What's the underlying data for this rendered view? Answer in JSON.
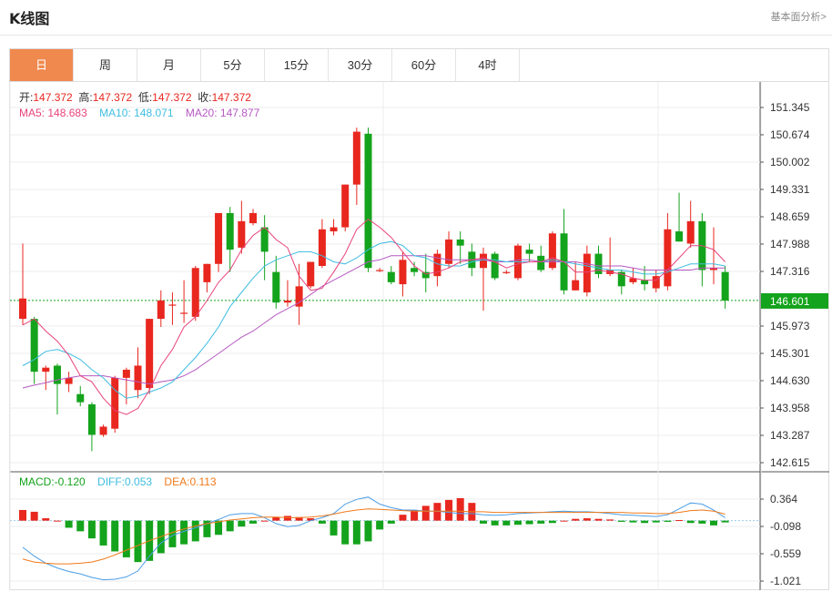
{
  "header": {
    "title": "K线图",
    "fund_link": "基本面分析>"
  },
  "tabs": [
    {
      "label": "日",
      "active": true
    },
    {
      "label": "周",
      "active": false
    },
    {
      "label": "月",
      "active": false
    },
    {
      "label": "5分",
      "active": false
    },
    {
      "label": "15分",
      "active": false
    },
    {
      "label": "30分",
      "active": false
    },
    {
      "label": "60分",
      "active": false
    },
    {
      "label": "4时",
      "active": false
    }
  ],
  "ohlc_info": {
    "open_label": "开:",
    "open": "147.372",
    "high_label": "高:",
    "high": "147.372",
    "low_label": "低:",
    "low": "147.372",
    "close_label": "收:",
    "close": "147.372"
  },
  "ma_info": {
    "ma5_label": "MA5:",
    "ma5": "148.683",
    "ma10_label": "MA10:",
    "ma10": "148.071",
    "ma20_label": "MA20:",
    "ma20": "147.877"
  },
  "macd_info": {
    "macd_label": "MACD:",
    "macd": "-0.120",
    "diff_label": "DIFF:",
    "diff": "0.053",
    "dea_label": "DEA:",
    "dea": "0.113"
  },
  "colors": {
    "up": "#e8271f",
    "down": "#14a31c",
    "ma5": "#e8437c",
    "ma10": "#3fbde0",
    "ma20": "#b659c2",
    "diff": "#4a9de6",
    "dea": "#f07a1a",
    "current_price_bg": "#14a31c",
    "active_tab": "#f0894e"
  },
  "chart_data": {
    "type": "candlestick",
    "current_price": "146.601",
    "current_price_value": 146.601,
    "y_ticks": [
      "151.345",
      "150.674",
      "150.002",
      "149.331",
      "148.659",
      "147.988",
      "147.316",
      "146.601",
      "145.973",
      "145.301",
      "144.630",
      "143.958",
      "143.287",
      "142.615"
    ],
    "macd_ticks": [
      "0.364",
      "-0.098",
      "-0.559",
      "-1.021"
    ],
    "ylim": [
      142.615,
      151.345
    ],
    "macd_ylim": [
      -1.021,
      0.364
    ],
    "candles": [
      {
        "o": 146.15,
        "h": 148.0,
        "l": 146.0,
        "c": 146.65
      },
      {
        "o": 146.15,
        "h": 146.2,
        "l": 144.55,
        "c": 144.85
      },
      {
        "o": 144.85,
        "h": 145.0,
        "l": 144.4,
        "c": 144.95
      },
      {
        "o": 145.0,
        "h": 145.05,
        "l": 143.8,
        "c": 144.55
      },
      {
        "o": 144.55,
        "h": 144.85,
        "l": 144.35,
        "c": 144.7
      },
      {
        "o": 144.3,
        "h": 144.5,
        "l": 144.0,
        "c": 144.1
      },
      {
        "o": 144.05,
        "h": 144.1,
        "l": 142.9,
        "c": 143.3
      },
      {
        "o": 143.3,
        "h": 143.55,
        "l": 143.25,
        "c": 143.5
      },
      {
        "o": 143.45,
        "h": 144.75,
        "l": 143.35,
        "c": 144.7
      },
      {
        "o": 144.7,
        "h": 144.95,
        "l": 144.05,
        "c": 144.9
      },
      {
        "o": 144.4,
        "h": 145.45,
        "l": 144.2,
        "c": 145.0
      },
      {
        "o": 144.45,
        "h": 146.15,
        "l": 144.3,
        "c": 146.15
      },
      {
        "o": 146.15,
        "h": 146.85,
        "l": 145.95,
        "c": 146.6
      },
      {
        "o": 146.5,
        "h": 146.8,
        "l": 146.0,
        "c": 146.5
      },
      {
        "o": 146.3,
        "h": 147.1,
        "l": 146.05,
        "c": 146.3
      },
      {
        "o": 146.2,
        "h": 147.45,
        "l": 146.1,
        "c": 147.4
      },
      {
        "o": 147.05,
        "h": 147.5,
        "l": 146.8,
        "c": 147.5
      },
      {
        "o": 147.5,
        "h": 148.4,
        "l": 147.3,
        "c": 148.75
      },
      {
        "o": 148.75,
        "h": 148.9,
        "l": 147.3,
        "c": 147.85
      },
      {
        "o": 147.9,
        "h": 149.05,
        "l": 147.75,
        "c": 148.55
      },
      {
        "o": 148.5,
        "h": 148.85,
        "l": 148.45,
        "c": 148.75
      },
      {
        "o": 148.4,
        "h": 148.7,
        "l": 147.1,
        "c": 147.8
      },
      {
        "o": 147.3,
        "h": 147.7,
        "l": 146.4,
        "c": 146.55
      },
      {
        "o": 146.55,
        "h": 147.1,
        "l": 146.45,
        "c": 146.6
      },
      {
        "o": 146.45,
        "h": 147.5,
        "l": 146.0,
        "c": 146.95
      },
      {
        "o": 146.95,
        "h": 147.55,
        "l": 146.9,
        "c": 147.55
      },
      {
        "o": 147.45,
        "h": 148.6,
        "l": 147.4,
        "c": 148.35
      },
      {
        "o": 148.3,
        "h": 148.6,
        "l": 148.2,
        "c": 148.4
      },
      {
        "o": 148.4,
        "h": 149.45,
        "l": 148.3,
        "c": 149.45
      },
      {
        "o": 149.45,
        "h": 150.85,
        "l": 148.95,
        "c": 150.75
      },
      {
        "o": 150.7,
        "h": 150.85,
        "l": 147.3,
        "c": 147.4
      },
      {
        "o": 147.35,
        "h": 147.4,
        "l": 147.3,
        "c": 147.35
      },
      {
        "o": 147.3,
        "h": 147.45,
        "l": 147.0,
        "c": 147.05
      },
      {
        "o": 147.0,
        "h": 147.8,
        "l": 146.7,
        "c": 147.6
      },
      {
        "o": 147.4,
        "h": 147.55,
        "l": 147.2,
        "c": 147.3
      },
      {
        "o": 147.3,
        "h": 147.75,
        "l": 146.8,
        "c": 147.15
      },
      {
        "o": 147.2,
        "h": 147.85,
        "l": 146.95,
        "c": 147.75
      },
      {
        "o": 147.5,
        "h": 148.3,
        "l": 147.4,
        "c": 148.1
      },
      {
        "o": 148.1,
        "h": 148.3,
        "l": 147.5,
        "c": 147.95
      },
      {
        "o": 147.8,
        "h": 148.0,
        "l": 147.2,
        "c": 147.4
      },
      {
        "o": 147.4,
        "h": 147.9,
        "l": 146.35,
        "c": 147.75
      },
      {
        "o": 147.75,
        "h": 147.8,
        "l": 147.1,
        "c": 147.15
      },
      {
        "o": 147.3,
        "h": 147.35,
        "l": 147.25,
        "c": 147.3
      },
      {
        "o": 147.15,
        "h": 148.0,
        "l": 147.1,
        "c": 147.95
      },
      {
        "o": 147.85,
        "h": 148.0,
        "l": 147.55,
        "c": 147.75
      },
      {
        "o": 147.7,
        "h": 147.95,
        "l": 147.3,
        "c": 147.35
      },
      {
        "o": 147.4,
        "h": 148.3,
        "l": 147.35,
        "c": 148.25
      },
      {
        "o": 148.25,
        "h": 148.85,
        "l": 146.75,
        "c": 146.85
      },
      {
        "o": 146.85,
        "h": 147.55,
        "l": 146.85,
        "c": 147.1
      },
      {
        "o": 146.8,
        "h": 147.95,
        "l": 146.7,
        "c": 147.75
      },
      {
        "o": 147.75,
        "h": 147.95,
        "l": 147.15,
        "c": 147.25
      },
      {
        "o": 147.25,
        "h": 148.15,
        "l": 147.2,
        "c": 147.35
      },
      {
        "o": 147.3,
        "h": 147.35,
        "l": 146.75,
        "c": 146.95
      },
      {
        "o": 147.05,
        "h": 147.4,
        "l": 147.0,
        "c": 147.15
      },
      {
        "o": 147.1,
        "h": 147.45,
        "l": 146.85,
        "c": 147.0
      },
      {
        "o": 146.9,
        "h": 147.35,
        "l": 146.8,
        "c": 147.2
      },
      {
        "o": 146.95,
        "h": 148.75,
        "l": 146.85,
        "c": 148.35
      },
      {
        "o": 148.3,
        "h": 149.25,
        "l": 148.05,
        "c": 148.05
      },
      {
        "o": 148.0,
        "h": 149.05,
        "l": 147.9,
        "c": 148.55
      },
      {
        "o": 148.55,
        "h": 148.75,
        "l": 146.95,
        "c": 147.35
      },
      {
        "o": 147.35,
        "h": 148.4,
        "l": 147.0,
        "c": 147.4
      },
      {
        "o": 147.3,
        "h": 147.45,
        "l": 146.4,
        "c": 146.6
      }
    ],
    "ma5": [
      146.0,
      146.15,
      145.85,
      145.6,
      145.25,
      144.75,
      144.6,
      144.2,
      143.9,
      143.8,
      143.95,
      144.4,
      145.0,
      145.4,
      145.95,
      146.2,
      146.6,
      147.05,
      147.35,
      147.85,
      148.2,
      148.4,
      148.1,
      147.9,
      147.2,
      146.85,
      146.9,
      147.3,
      147.75,
      148.35,
      148.6,
      148.4,
      148.15,
      147.8,
      147.45,
      147.25,
      147.3,
      147.4,
      147.55,
      147.6,
      147.65,
      147.55,
      147.4,
      147.5,
      147.55,
      147.55,
      147.65,
      147.55,
      147.3,
      147.3,
      147.35,
      147.3,
      147.25,
      147.15,
      147.1,
      147.1,
      147.35,
      147.65,
      147.95,
      147.95,
      147.85,
      147.55
    ],
    "ma10": [
      145.0,
      145.15,
      145.35,
      145.4,
      145.3,
      145.15,
      144.9,
      144.7,
      144.4,
      144.2,
      144.25,
      144.35,
      144.45,
      144.6,
      144.9,
      145.2,
      145.55,
      145.95,
      146.45,
      146.8,
      147.15,
      147.45,
      147.6,
      147.7,
      147.8,
      147.8,
      147.7,
      147.55,
      147.5,
      147.65,
      147.85,
      148.0,
      148.05,
      147.95,
      147.7,
      147.65,
      147.5,
      147.45,
      147.45,
      147.55,
      147.6,
      147.6,
      147.55,
      147.55,
      147.55,
      147.55,
      147.6,
      147.55,
      147.5,
      147.45,
      147.4,
      147.35,
      147.35,
      147.3,
      147.25,
      147.25,
      147.3,
      147.4,
      147.5,
      147.5,
      147.5,
      147.45
    ],
    "ma20": [
      144.45,
      144.52,
      144.58,
      144.65,
      144.7,
      144.75,
      144.75,
      144.75,
      144.7,
      144.65,
      144.6,
      144.55,
      144.6,
      144.65,
      144.75,
      144.9,
      145.1,
      145.3,
      145.5,
      145.7,
      145.85,
      146.05,
      146.25,
      146.4,
      146.55,
      146.75,
      146.95,
      147.1,
      147.25,
      147.4,
      147.55,
      147.6,
      147.7,
      147.7,
      147.7,
      147.7,
      147.65,
      147.6,
      147.6,
      147.6,
      147.6,
      147.55,
      147.55,
      147.6,
      147.6,
      147.55,
      147.55,
      147.55,
      147.55,
      147.5,
      147.45,
      147.45,
      147.45,
      147.4,
      147.35,
      147.35,
      147.35,
      147.35,
      147.35,
      147.4,
      147.4,
      147.4
    ],
    "macd_hist": [
      0.18,
      0.15,
      0.04,
      0.0,
      -0.12,
      -0.18,
      -0.3,
      -0.42,
      -0.52,
      -0.62,
      -0.7,
      -0.68,
      -0.55,
      -0.45,
      -0.4,
      -0.35,
      -0.28,
      -0.24,
      -0.18,
      -0.1,
      -0.05,
      0.0,
      0.06,
      0.08,
      0.06,
      0.04,
      -0.05,
      -0.25,
      -0.4,
      -0.4,
      -0.35,
      -0.15,
      -0.05,
      0.1,
      0.18,
      0.25,
      0.3,
      0.35,
      0.38,
      0.3,
      -0.05,
      -0.08,
      -0.08,
      -0.07,
      -0.06,
      -0.05,
      -0.04,
      0.0,
      0.03,
      0.04,
      0.03,
      0.02,
      -0.02,
      -0.03,
      -0.04,
      -0.03,
      -0.02,
      0.01,
      -0.04,
      -0.05,
      -0.08,
      -0.03
    ],
    "diff": [
      -0.45,
      -0.6,
      -0.72,
      -0.8,
      -0.86,
      -0.9,
      -0.96,
      -1.0,
      -0.99,
      -0.95,
      -0.85,
      -0.6,
      -0.38,
      -0.25,
      -0.18,
      -0.12,
      -0.05,
      0.02,
      0.1,
      0.12,
      0.12,
      0.05,
      -0.05,
      -0.1,
      -0.08,
      0.0,
      0.05,
      0.12,
      0.28,
      0.36,
      0.4,
      0.28,
      0.22,
      0.18,
      0.18,
      0.16,
      0.16,
      0.14,
      0.12,
      0.12,
      0.1,
      0.09,
      0.1,
      0.12,
      0.13,
      0.14,
      0.15,
      0.16,
      0.15,
      0.15,
      0.14,
      0.12,
      0.1,
      0.09,
      0.08,
      0.07,
      0.1,
      0.2,
      0.3,
      0.28,
      0.18,
      0.05
    ],
    "dea": [
      -0.65,
      -0.7,
      -0.72,
      -0.73,
      -0.73,
      -0.72,
      -0.7,
      -0.65,
      -0.58,
      -0.5,
      -0.42,
      -0.34,
      -0.27,
      -0.2,
      -0.14,
      -0.09,
      -0.05,
      -0.02,
      0.01,
      0.03,
      0.05,
      0.06,
      0.06,
      0.05,
      0.05,
      0.06,
      0.08,
      0.11,
      0.15,
      0.18,
      0.2,
      0.19,
      0.18,
      0.17,
      0.16,
      0.16,
      0.16,
      0.16,
      0.16,
      0.15,
      0.15,
      0.14,
      0.14,
      0.14,
      0.14,
      0.14,
      0.14,
      0.14,
      0.14,
      0.14,
      0.14,
      0.14,
      0.14,
      0.13,
      0.13,
      0.12,
      0.12,
      0.14,
      0.17,
      0.18,
      0.16,
      0.11
    ]
  }
}
